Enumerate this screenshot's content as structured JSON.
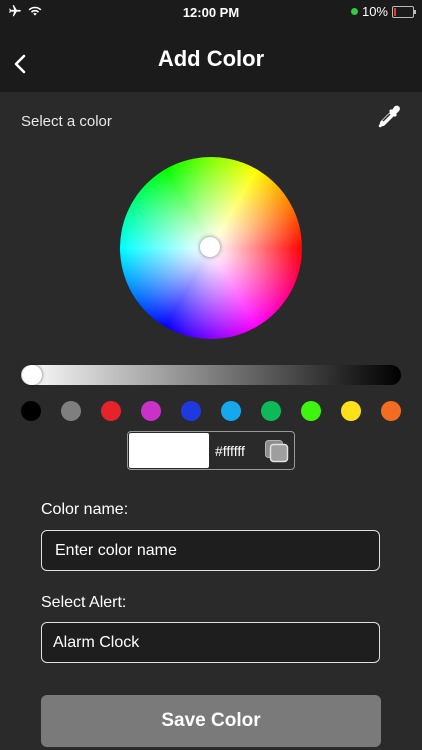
{
  "status_bar": {
    "time": "12:00 PM",
    "battery_percent": "10%",
    "icons": [
      "airplane-icon",
      "wifi-icon",
      "battery-icon"
    ]
  },
  "nav": {
    "title": "Add Color",
    "back_icon": "chevron-left-icon"
  },
  "picker": {
    "label": "Select a color",
    "eyedropper_icon": "eyedropper-icon",
    "brightness_level": 0.0
  },
  "swatches": [
    {
      "name": "black",
      "color": "#000000"
    },
    {
      "name": "gray",
      "color": "#7f7f7f"
    },
    {
      "name": "red",
      "color": "#e5232b"
    },
    {
      "name": "magenta",
      "color": "#c931c8"
    },
    {
      "name": "blue",
      "color": "#1f39e0"
    },
    {
      "name": "sky-blue",
      "color": "#16a8ec"
    },
    {
      "name": "green",
      "color": "#0cbb57"
    },
    {
      "name": "lime",
      "color": "#3df50e"
    },
    {
      "name": "yellow",
      "color": "#fde21b"
    },
    {
      "name": "orange",
      "color": "#f26c22"
    }
  ],
  "hex": {
    "value": "#ffffff",
    "preview_color": "#ffffff",
    "copy_icon": "copy-icon"
  },
  "form": {
    "color_name_label": "Color name:",
    "color_name_placeholder": "Enter color name",
    "alert_label": "Select Alert:",
    "alert_value": "Alarm Clock"
  },
  "save_button": "Save Color",
  "colors": {
    "background": "#2a2a2a",
    "bars": "#1b1b1b",
    "button": "#7a7a7a"
  }
}
